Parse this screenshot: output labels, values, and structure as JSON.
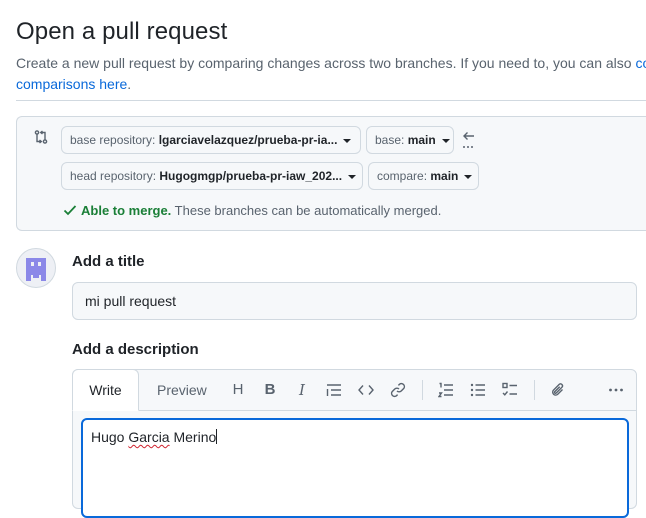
{
  "page": {
    "title": "Open a pull request",
    "subtitle_line1": "Create a new pull request by comparing changes across two branches. If you need to, you can also ",
    "subtitle_link_start": "cor",
    "subtitle_link_end": "comparisons here",
    "subtitle_end_punct": "."
  },
  "compare": {
    "base_repo_label": "base repository: ",
    "base_repo_value": "lgarciavelazquez/prueba-pr-ia...",
    "base_label": "base: ",
    "base_value": "main",
    "head_repo_label": "head repository: ",
    "head_repo_value": "Hugogmgp/prueba-pr-iaw_202...",
    "compare_label": "compare: ",
    "compare_value": "main",
    "merge_ok": "Able to merge.",
    "merge_note": " These branches can be automatically merged.",
    "swap_dots": "..."
  },
  "form": {
    "title_heading": "Add a title",
    "title_value": "mi pull request",
    "description_heading": "Add a description",
    "tab_write": "Write",
    "tab_preview": "Preview",
    "description_value_pre": "Hugo ",
    "description_value_spell": "Garcia",
    "description_value_post": " Merino"
  },
  "toolbar": {
    "heading": "H",
    "bold": "B",
    "italic": "I",
    "quote": "quote-icon",
    "code": "code-icon",
    "link": "link-icon",
    "ordered_list": "ordered-list-icon",
    "unordered_list": "unordered-list-icon",
    "task_list": "task-list-icon",
    "attach": "paperclip-icon",
    "more": "kebab-horizontal-icon"
  },
  "colors": {
    "link": "#0969da",
    "success": "#1a7f37",
    "focus": "#0969da",
    "avatar": "#8b88e8"
  }
}
